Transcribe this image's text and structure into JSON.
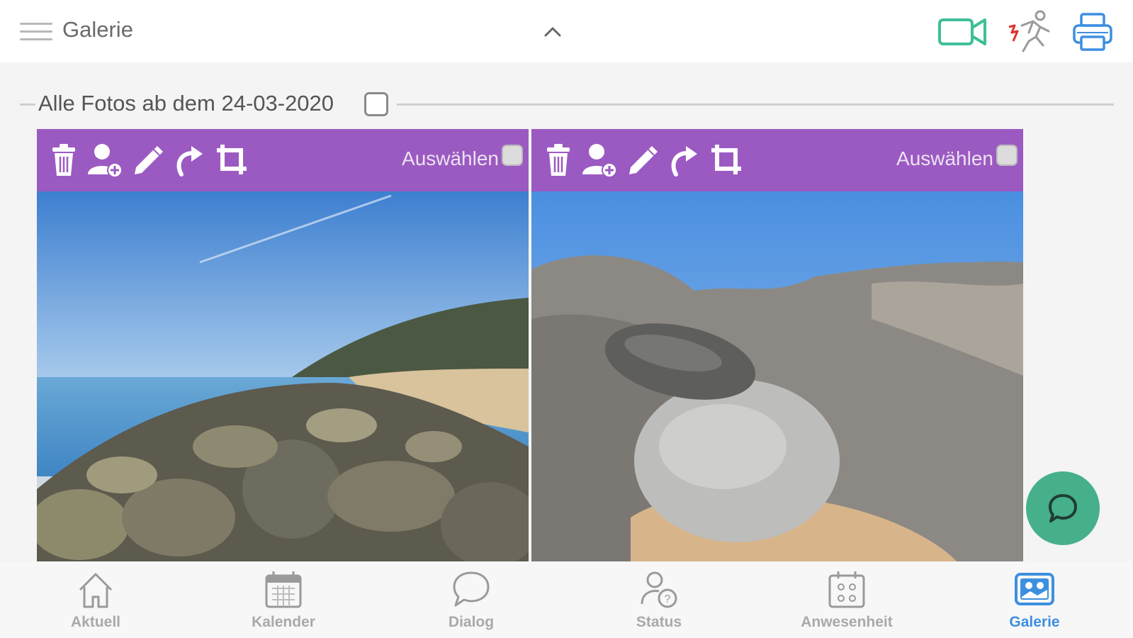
{
  "header": {
    "title": "Galerie",
    "icons": [
      "menu-icon",
      "chevron-up-icon",
      "video-camera-icon",
      "running-person-icon",
      "printer-icon"
    ],
    "colors": {
      "video": "#3dbf98",
      "runner_accent": "#e0302a",
      "printer": "#3d8fe0"
    }
  },
  "section": {
    "title": "Alle Fotos ab dem 24-03-2020",
    "checked": false
  },
  "photos": [
    {
      "toolbar": {
        "icons": [
          "trash-icon",
          "add-user-icon",
          "pencil-icon",
          "rotate-icon",
          "crop-icon"
        ],
        "select_label": "Auswählen"
      },
      "selected": false,
      "subject": "beach-rocks"
    },
    {
      "toolbar": {
        "icons": [
          "trash-icon",
          "add-user-icon",
          "pencil-icon",
          "rotate-icon",
          "crop-icon"
        ],
        "select_label": "Auswählen"
      },
      "selected": false,
      "subject": "stacked-stones"
    }
  ],
  "toolbar_color": "#9b5ac1",
  "chat_button": {
    "icon": "chat-bubble-icon",
    "color": "#46b08b"
  },
  "bottom_nav": {
    "items": [
      {
        "label": "Aktuell",
        "icon": "home-icon",
        "active": false
      },
      {
        "label": "Kalender",
        "icon": "calendar-icon",
        "active": false
      },
      {
        "label": "Dialog",
        "icon": "speech-bubble-icon",
        "active": false
      },
      {
        "label": "Status",
        "icon": "user-status-icon",
        "active": false
      },
      {
        "label": "Anwesenheit",
        "icon": "attendance-icon",
        "active": false
      },
      {
        "label": "Galerie",
        "icon": "gallery-icon",
        "active": true
      }
    ],
    "active_color": "#3d8fe0",
    "inactive_color": "#a9a9a9"
  }
}
